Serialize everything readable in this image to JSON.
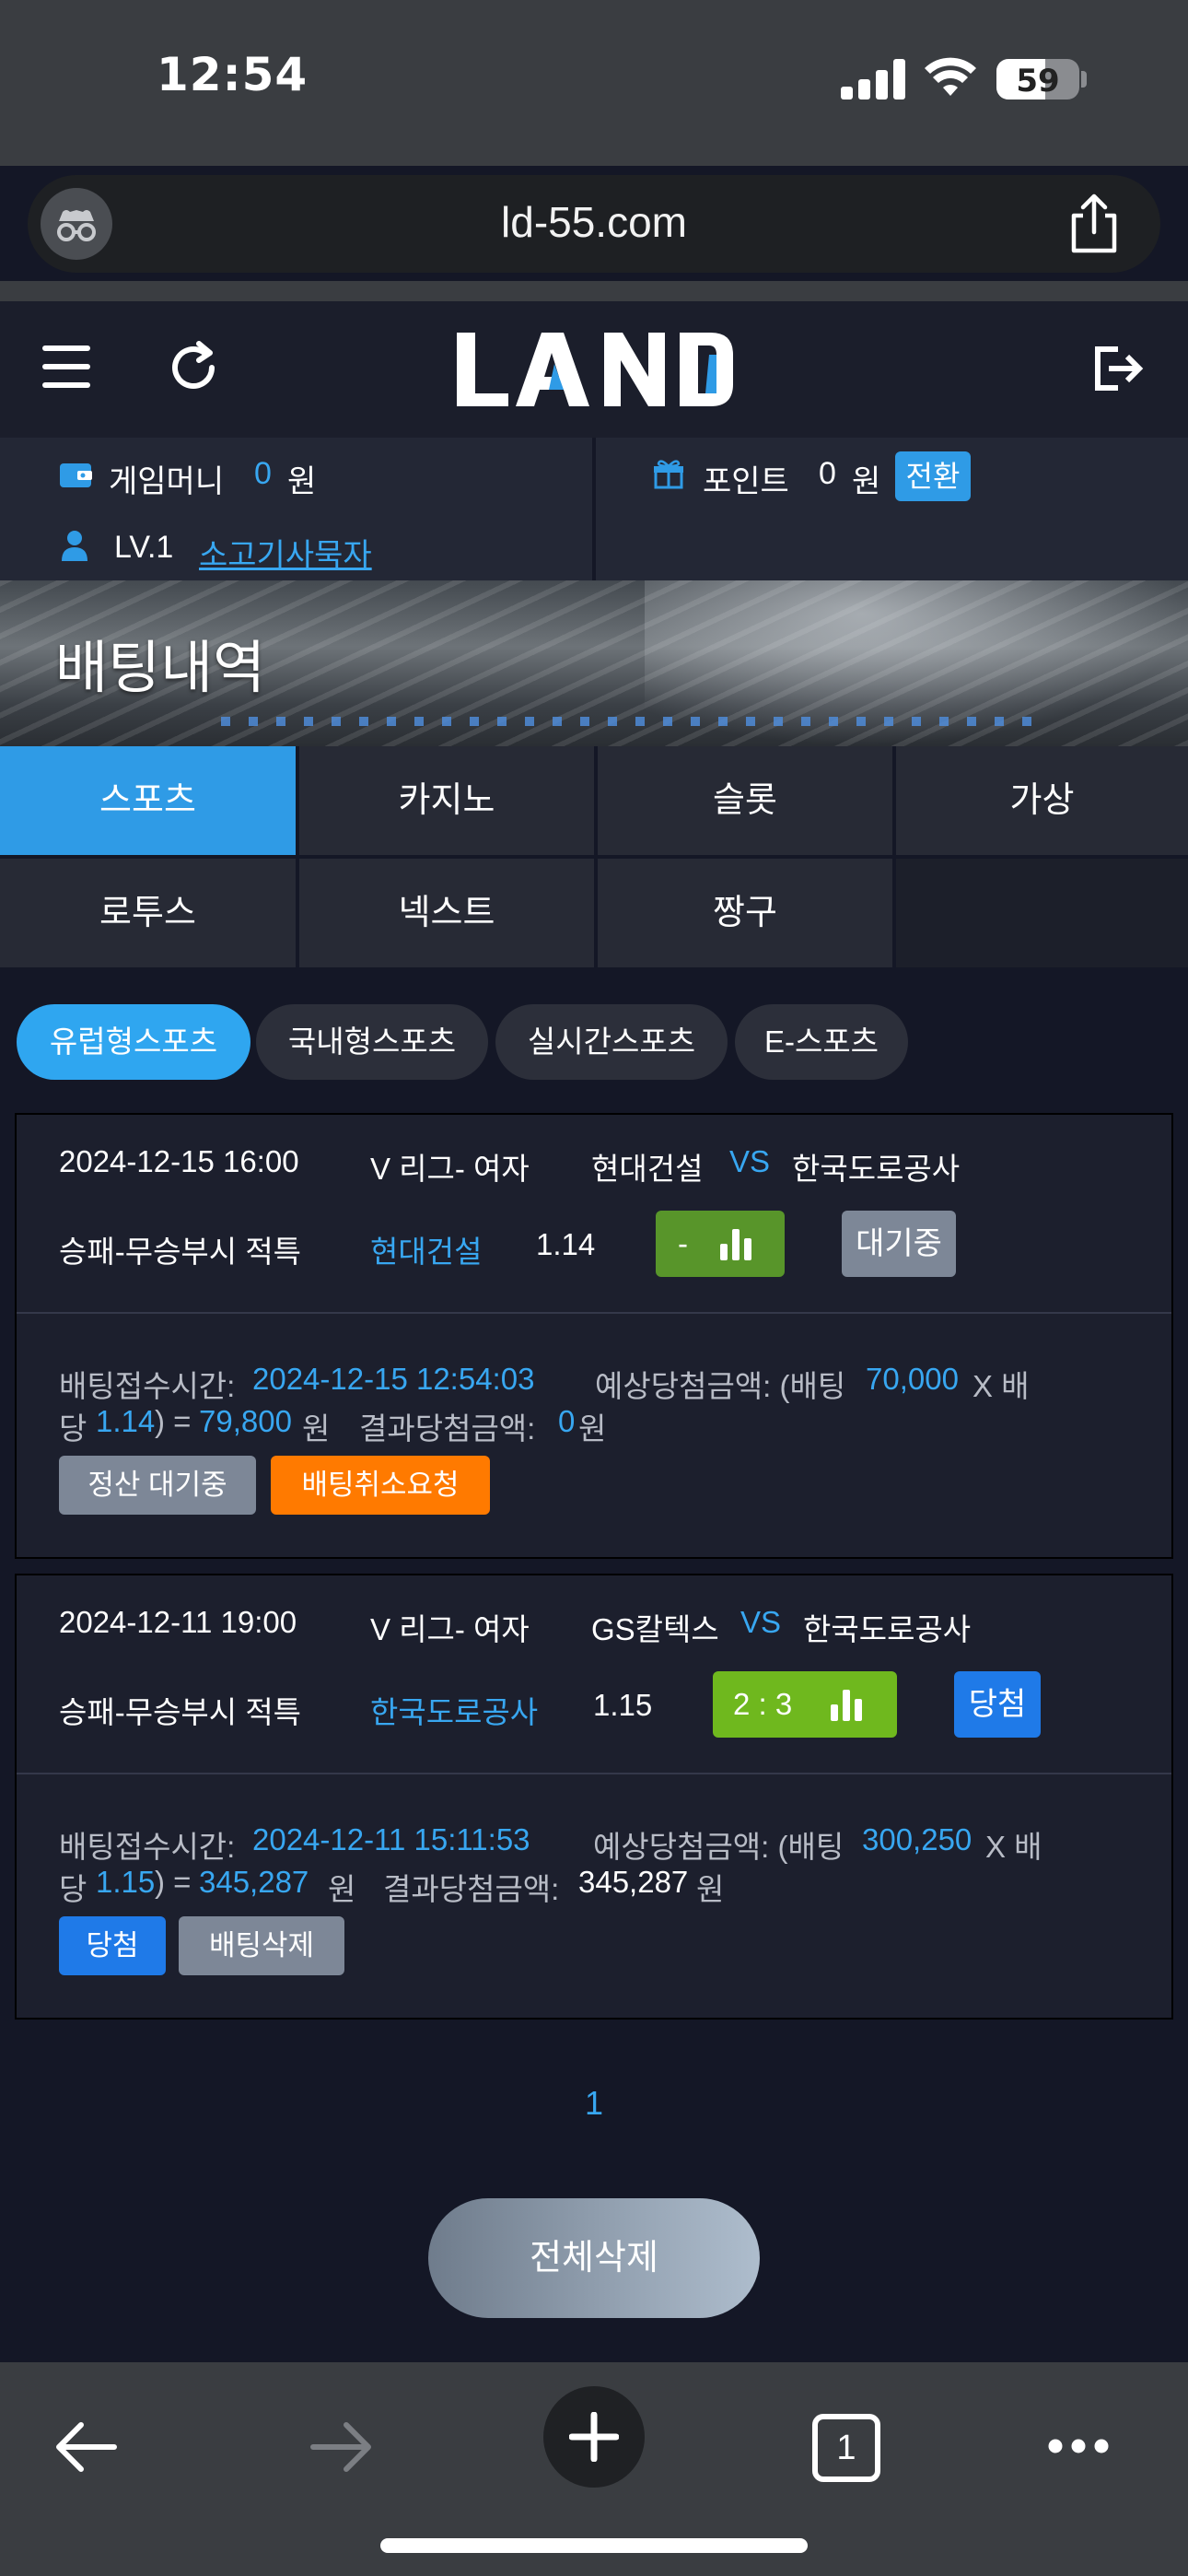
{
  "status_bar": {
    "time": "12:54",
    "battery": "59",
    "battery_level": 0.59
  },
  "browser": {
    "url": "ld-55.com"
  },
  "site": {
    "logo": "LAND"
  },
  "account": {
    "game_money_label": "게임머니",
    "game_money_value": "0",
    "game_money_unit": "원",
    "points_label": "포인트",
    "points_value": "0",
    "points_unit": "원",
    "swap_label": "전환",
    "level": "LV.1",
    "username": "소고기사묵자"
  },
  "banner": {
    "title": "배팅내역"
  },
  "tabs": [
    "스포츠",
    "카지노",
    "슬롯",
    "가상",
    "로투스",
    "넥스트",
    "짱구"
  ],
  "subtabs": [
    "유럽형스포츠",
    "국내형스포츠",
    "실시간스포츠",
    "E-스포츠"
  ],
  "bets": [
    {
      "datetime": "2024-12-15 16:00",
      "league": "V 리그- 여자",
      "home": "현대건설",
      "vs": "VS",
      "away": "한국도로공사",
      "market": "승패-무승부시 적특",
      "pick": "현대건설",
      "odds": "1.14",
      "score": "-",
      "status": "대기중",
      "receipt_label": "배팅접수시간:",
      "receipt_time": "2024-12-15  12:54:03",
      "expected_label": "예상당첨금액: (배팅",
      "stake": "70,000",
      "times_label": "X 배",
      "odds_prefix": "당",
      "odds_value": "1.14",
      "equals": ") =",
      "expected_value": "79,800",
      "won_unit": "원",
      "result_label": "결과당첨금액:",
      "result_value": "0",
      "result_unit": "원",
      "btn1": "정산  대기중",
      "btn2": "배팅취소요청"
    },
    {
      "datetime": "2024-12-11 19:00",
      "league": "V 리그- 여자",
      "home": "GS칼텍스",
      "vs": "VS",
      "away": "한국도로공사",
      "market": "승패-무승부시 적특",
      "pick": "한국도로공사",
      "odds": "1.15",
      "score": "2 : 3",
      "status": "당첨",
      "receipt_label": "배팅접수시간:",
      "receipt_time": "2024-12-11  15:11:53",
      "expected_label": "예상당첨금액: (배팅",
      "stake": "300,250",
      "times_label": "X 배",
      "odds_prefix": "당",
      "odds_value": "1.15",
      "equals": ") =",
      "expected_value": "345,287",
      "won_unit": "원",
      "result_label": "결과당첨금액:",
      "result_value": "345,287",
      "result_unit": "원",
      "btn1": "당첨",
      "btn2": "배팅삭제"
    }
  ],
  "pagination": {
    "current": "1"
  },
  "delete_all_label": "전체삭제",
  "safari_toolbar": {
    "tab_count": "1"
  },
  "colors": {
    "accent": "#2f9be6",
    "link": "#38a7f1",
    "cancel": "#ff7a00",
    "win": "#1f7ae8"
  }
}
